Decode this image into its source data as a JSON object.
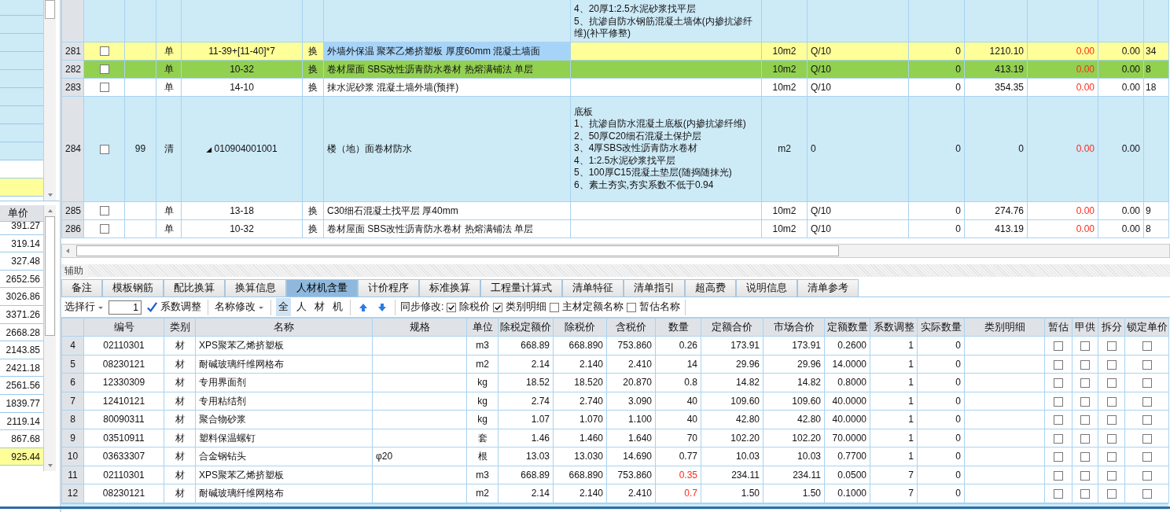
{
  "outline_rows": [
    {
      "color": "#cdeaf7"
    },
    {
      "color": "#cdeaf7"
    },
    {
      "color": "#cdeaf7"
    },
    {
      "color": "#cdeaf7"
    },
    {
      "color": "#cdeaf7"
    },
    {
      "color": "#cdeaf7"
    },
    {
      "color": "#cdeaf7"
    },
    {
      "color": "#cdeaf7"
    },
    {
      "color": "#cdeaf7"
    },
    {
      "color": "#ffffff"
    },
    {
      "color": "#ffff99"
    }
  ],
  "price_list": {
    "header": "单价",
    "items": [
      {
        "value": "391.27",
        "selected": false
      },
      {
        "value": "319.14",
        "selected": false
      },
      {
        "value": "327.48",
        "selected": false
      },
      {
        "value": "2652.56",
        "selected": false
      },
      {
        "value": "3026.86",
        "selected": false
      },
      {
        "value": "3371.26",
        "selected": false
      },
      {
        "value": "2668.28",
        "selected": false
      },
      {
        "value": "2143.85",
        "selected": false
      },
      {
        "value": "2421.18",
        "selected": false
      },
      {
        "value": "2561.56",
        "selected": false
      },
      {
        "value": "1839.77",
        "selected": false
      },
      {
        "value": "2119.14",
        "selected": false
      },
      {
        "value": "867.68",
        "selected": false
      },
      {
        "value": "925.44",
        "selected": true
      }
    ]
  },
  "main_table": {
    "rows": [
      {
        "kind": "cut",
        "color": "#cdeaf7",
        "description": [
          "4、20厚1:2.5水泥砂浆找平层",
          "5、抗渗自防水钢筋混凝土墙体(内掺抗渗纤",
          "维)(补平修整)"
        ]
      },
      {
        "kind": "item",
        "color": "#ffff99",
        "name_focused": true,
        "number": "281",
        "checked": false,
        "type": "单",
        "code": "11-39+[11-40]*7",
        "tag": "换",
        "name": "外墙外保温 聚苯乙烯挤塑板 厚度60mm 混凝土墙面",
        "unit": "10m2",
        "column_10": "Q/10",
        "column_11": "0",
        "column_12": "1210.10",
        "column_13": "0.00",
        "column_14": "0.00",
        "column_15": "34"
      },
      {
        "kind": "item",
        "color": "#92d050",
        "name_focused": false,
        "number": "282",
        "checked": false,
        "type": "单",
        "code": "10-32",
        "tag": "换",
        "name": "卷材屋面 SBS改性沥青防水卷材 热熔满铺法 单层",
        "unit": "10m2",
        "column_10": "Q/10",
        "column_11": "0",
        "column_12": "413.19",
        "column_13": "0.00",
        "column_14": "0.00",
        "column_15": "8"
      },
      {
        "kind": "item",
        "color": "#ffffff",
        "name_focused": false,
        "number": "283",
        "checked": false,
        "type": "单",
        "code": "14-10",
        "tag": "换",
        "name": "抹水泥砂浆 混凝土墙外墙(预拌)",
        "unit": "10m2",
        "column_10": "Q/10",
        "column_11": "0",
        "column_12": "354.35",
        "column_13": "0.00",
        "column_14": "0.00",
        "column_15": "18"
      },
      {
        "kind": "item",
        "color": "#cdeaf7",
        "name_focused": false,
        "number": "284",
        "checked": false,
        "column_3": "99",
        "type": "清",
        "toggle": "◢",
        "code": "010904001001",
        "name": "楼（地）面卷材防水",
        "description": [
          "底板",
          "1、抗渗自防水混凝土底板(内掺抗渗纤维)",
          "2、50厚C20细石混凝土保护层",
          "3、4厚SBS改性沥青防水卷材",
          "4、1:2.5水泥砂浆找平层",
          "5、100厚C15混凝土垫层(随捣随抹光)",
          "6、素土夯实,夯实系数不低于0.94"
        ],
        "unit": "m2",
        "column_10": "0",
        "column_11": "0",
        "column_12": "0",
        "column_13": "0.00",
        "column_14": "0.00"
      },
      {
        "kind": "item",
        "color": "#ffffff",
        "name_focused": false,
        "number": "285",
        "checked": false,
        "type": "单",
        "code": "13-18",
        "tag": "换",
        "name": "C30细石混凝土找平层 厚40mm",
        "unit": "10m2",
        "column_10": "Q/10",
        "column_11": "0",
        "column_12": "274.76",
        "column_13": "0.00",
        "column_14": "0.00",
        "column_15": "9"
      },
      {
        "kind": "item",
        "color": "#ffffff",
        "name_focused": false,
        "number": "286",
        "checked": false,
        "type": "单",
        "code": "10-32",
        "tag": "换",
        "name": "卷材屋面 SBS改性沥青防水卷材 热熔满铺法 单层",
        "unit": "10m2",
        "column_10": "Q/10",
        "column_11": "0",
        "column_12": "413.19",
        "column_13": "0.00",
        "column_14": "0.00",
        "column_15": "8"
      }
    ]
  },
  "auxiliary": {
    "title": "辅助",
    "tabs": [
      {
        "label": "备注",
        "selected": false
      },
      {
        "label": "模板钢筋",
        "selected": false
      },
      {
        "label": "配比换算",
        "selected": false
      },
      {
        "label": "换算信息",
        "selected": false
      },
      {
        "label": "人材机含量",
        "selected": true
      },
      {
        "label": "计价程序",
        "selected": false
      },
      {
        "label": "标准换算",
        "selected": false
      },
      {
        "label": "工程量计算式",
        "selected": false
      },
      {
        "label": "清单特征",
        "selected": false
      },
      {
        "label": "清单指引",
        "selected": false
      },
      {
        "label": "超高费",
        "selected": false
      },
      {
        "label": "说明信息",
        "selected": false
      },
      {
        "label": "清单参考",
        "selected": false
      }
    ],
    "toolbar": {
      "row_select": "选择行",
      "row_value": "1",
      "coefficient_button": "系数调整",
      "rename_menu": "名称修改",
      "filters": [
        {
          "label": "全",
          "selected": true
        },
        {
          "label": "人",
          "selected": false
        },
        {
          "label": "材",
          "selected": false
        },
        {
          "label": "机",
          "selected": false
        }
      ],
      "sync_label": "同步修改:",
      "sync_options": [
        {
          "label": "除税价",
          "checked": true
        },
        {
          "label": "类别明细",
          "checked": true
        },
        {
          "label": "主材定额名称",
          "checked": false
        },
        {
          "label": "暂估名称",
          "checked": false
        }
      ]
    },
    "table": {
      "columns": [
        "编号",
        "类别",
        "名称",
        "规格",
        "单位",
        "除税定额价",
        "除税价",
        "含税价",
        "数量",
        "定额合价",
        "市场合价",
        "定额数量",
        "系数调整",
        "实际数量",
        "类别明细",
        "暂估",
        "甲供",
        "拆分",
        "锁定单价"
      ],
      "rows": [
        {
          "number": "4",
          "code": "02110301",
          "category": "材",
          "name": "XPS聚苯乙烯挤塑板",
          "unit": "m3",
          "base_price": "668.89",
          "price": "668.890",
          "tax_price": "753.860",
          "quantity": "0.26",
          "quantity_changed": false,
          "base_total": "173.91",
          "market_total": "173.91",
          "base_quantity": "0.2600",
          "coefficient": "1",
          "actual_quantity": "0",
          "flags": [
            false,
            false,
            false,
            false
          ]
        },
        {
          "number": "5",
          "code": "08230121",
          "category": "材",
          "name": "耐碱玻璃纤维网格布",
          "unit": "m2",
          "base_price": "2.14",
          "price": "2.140",
          "tax_price": "2.410",
          "quantity": "14",
          "quantity_changed": false,
          "base_total": "29.96",
          "market_total": "29.96",
          "base_quantity": "14.0000",
          "coefficient": "1",
          "actual_quantity": "0",
          "flags": [
            false,
            false,
            false,
            false
          ]
        },
        {
          "number": "6",
          "code": "12330309",
          "category": "材",
          "name": "专用界面剂",
          "unit": "kg",
          "base_price": "18.52",
          "price": "18.520",
          "tax_price": "20.870",
          "quantity": "0.8",
          "quantity_changed": false,
          "base_total": "14.82",
          "market_total": "14.82",
          "base_quantity": "0.8000",
          "coefficient": "1",
          "actual_quantity": "0",
          "flags": [
            false,
            false,
            false,
            false
          ]
        },
        {
          "number": "7",
          "code": "12410121",
          "category": "材",
          "name": "专用粘结剂",
          "unit": "kg",
          "base_price": "2.74",
          "price": "2.740",
          "tax_price": "3.090",
          "quantity": "40",
          "quantity_changed": false,
          "base_total": "109.60",
          "market_total": "109.60",
          "base_quantity": "40.0000",
          "coefficient": "1",
          "actual_quantity": "0",
          "flags": [
            false,
            false,
            false,
            false
          ]
        },
        {
          "number": "8",
          "code": "80090311",
          "category": "材",
          "name": "聚合物砂浆",
          "unit": "kg",
          "base_price": "1.07",
          "price": "1.070",
          "tax_price": "1.100",
          "quantity": "40",
          "quantity_changed": false,
          "base_total": "42.80",
          "market_total": "42.80",
          "base_quantity": "40.0000",
          "coefficient": "1",
          "actual_quantity": "0",
          "flags": [
            false,
            false,
            false,
            false
          ]
        },
        {
          "number": "9",
          "code": "03510911",
          "category": "材",
          "name": "塑料保温螺钉",
          "unit": "套",
          "base_price": "1.46",
          "price": "1.460",
          "tax_price": "1.640",
          "quantity": "70",
          "quantity_changed": false,
          "base_total": "102.20",
          "market_total": "102.20",
          "base_quantity": "70.0000",
          "coefficient": "1",
          "actual_quantity": "0",
          "flags": [
            false,
            false,
            false,
            false
          ]
        },
        {
          "number": "10",
          "code": "03633307",
          "category": "材",
          "name": "合金钢钻头",
          "spec": "φ20",
          "unit": "根",
          "base_price": "13.03",
          "price": "13.030",
          "tax_price": "14.690",
          "quantity": "0.77",
          "quantity_changed": false,
          "base_total": "10.03",
          "market_total": "10.03",
          "base_quantity": "0.7700",
          "coefficient": "1",
          "actual_quantity": "0",
          "flags": [
            false,
            false,
            false,
            false
          ]
        },
        {
          "number": "11",
          "code": "02110301",
          "category": "材",
          "name": "XPS聚苯乙烯挤塑板",
          "unit": "m3",
          "base_price": "668.89",
          "price": "668.890",
          "tax_price": "753.860",
          "quantity": "0.35",
          "quantity_changed": true,
          "base_total": "234.11",
          "market_total": "234.11",
          "base_quantity": "0.0500",
          "coefficient": "7",
          "actual_quantity": "0",
          "flags": [
            false,
            false,
            false,
            false
          ]
        },
        {
          "number": "12",
          "code": "08230121",
          "category": "材",
          "name": "耐碱玻璃纤维网格布",
          "unit": "m2",
          "base_price": "2.14",
          "price": "2.140",
          "tax_price": "2.410",
          "quantity": "0.7",
          "quantity_changed": true,
          "base_total": "1.50",
          "market_total": "1.50",
          "base_quantity": "0.1000",
          "coefficient": "7",
          "actual_quantity": "0",
          "flags": [
            false,
            false,
            false,
            false
          ]
        }
      ]
    }
  }
}
